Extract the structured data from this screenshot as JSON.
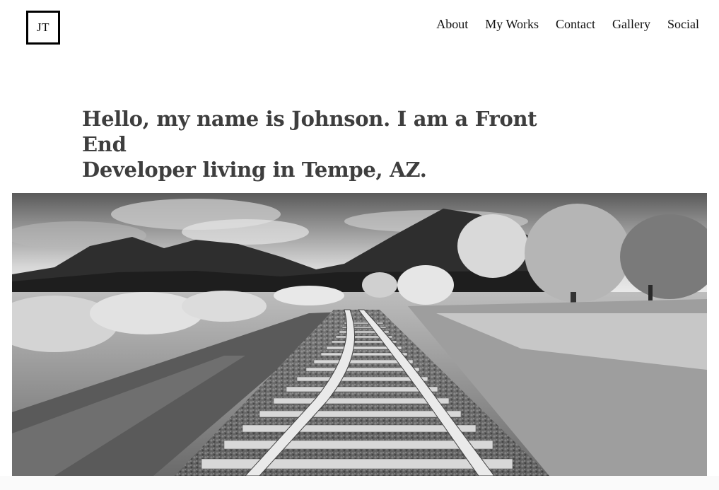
{
  "header": {
    "logo_text": "JT",
    "nav": [
      {
        "label": "About"
      },
      {
        "label": "My Works"
      },
      {
        "label": "Contact"
      },
      {
        "label": "Gallery"
      },
      {
        "label": "Social"
      }
    ]
  },
  "hero": {
    "line1": "Hello, my name is Johnson. I am a Front End",
    "line2": "Developer living in Tempe, AZ."
  },
  "photo": {
    "subject": "railroad-tracks-landscape",
    "style": "black-and-white"
  }
}
